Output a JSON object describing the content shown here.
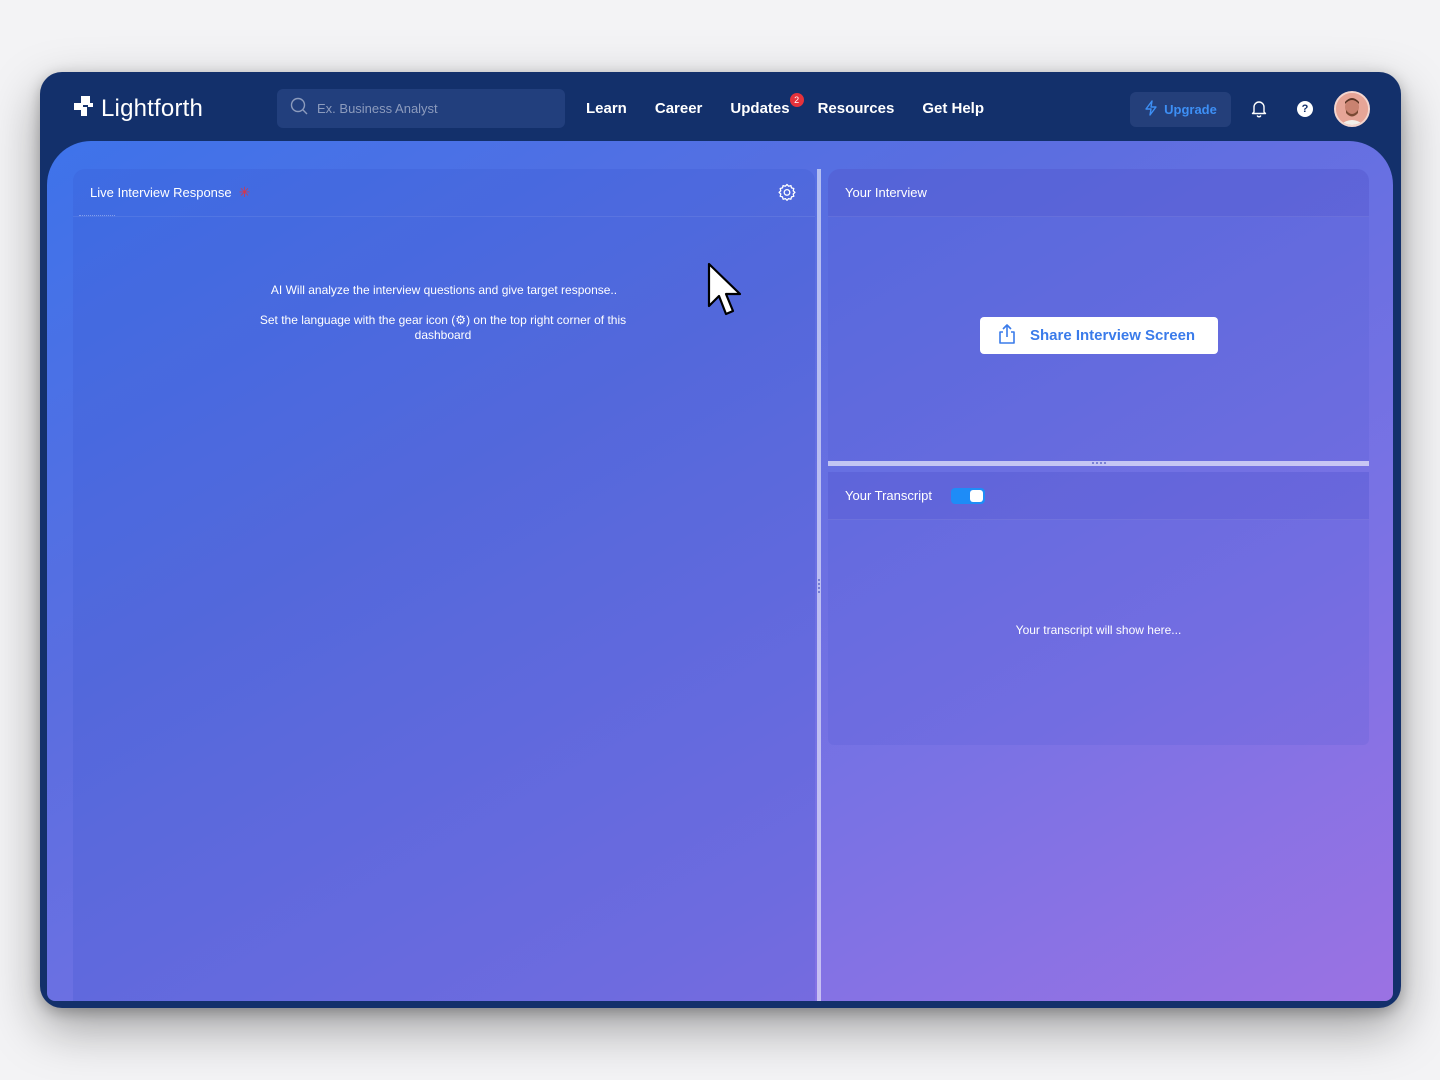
{
  "brand": {
    "name": "Lightforth"
  },
  "search": {
    "placeholder": "Ex. Business Analyst"
  },
  "nav": {
    "items": [
      {
        "label": "Learn"
      },
      {
        "label": "Career"
      },
      {
        "label": "Updates",
        "badge": "2"
      },
      {
        "label": "Resources"
      },
      {
        "label": "Get Help"
      }
    ]
  },
  "header": {
    "upgrade_label": "Upgrade",
    "help_glyph": "?"
  },
  "live_panel": {
    "title": "Live Interview Response",
    "live_indicator": "✳",
    "line1": "AI Will analyze the interview questions and give target response..",
    "line2": "Set the language with the gear icon (⚙) on the top right corner of this dashboard"
  },
  "interview_panel": {
    "title": "Your Interview",
    "share_label": "Share Interview Screen"
  },
  "transcript_panel": {
    "title": "Your Transcript",
    "toggle_on": true,
    "placeholder": "Your transcript will show here..."
  },
  "colors": {
    "navbar": "#13306b",
    "accent": "#3a7bea",
    "badge": "#e5323b",
    "toggle": "#1e8cf7"
  },
  "icons": [
    "logo-icon",
    "search-icon",
    "bolt-icon",
    "bell-icon",
    "help-icon",
    "gear-icon",
    "share-icon",
    "cursor-icon"
  ]
}
